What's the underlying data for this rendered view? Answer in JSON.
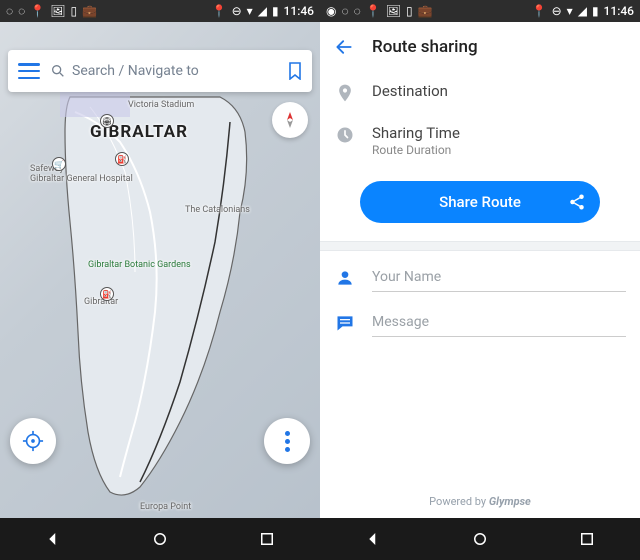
{
  "status": {
    "time": "11:46",
    "icons_left": [
      "messenger",
      "bulb",
      "bulb",
      "pin",
      "image",
      "tablet",
      "briefcase"
    ],
    "icons_right": [
      "pin",
      "minus",
      "wifi",
      "signal",
      "battery"
    ]
  },
  "left": {
    "search_placeholder": "Search / Navigate to",
    "map_labels": {
      "title": "GIBRALTAR",
      "stadium": "Victoria Stadium",
      "safeway": "Safeway",
      "hospital": "Gibraltar General Hospital",
      "catalonians": "The Catalonians",
      "botanic": "Gibraltar Botanic Gardens",
      "gibraltar_small": "Gibraltar",
      "europa": "Europa Point"
    }
  },
  "right": {
    "title": "Route sharing",
    "destination_label": "Destination",
    "sharing_time_label": "Sharing Time",
    "sharing_time_sub": "Route Duration",
    "share_button": "Share Route",
    "name_placeholder": "Your Name",
    "message_placeholder": "Message",
    "powered_prefix": "Powered by ",
    "powered_brand": "Glympse"
  }
}
